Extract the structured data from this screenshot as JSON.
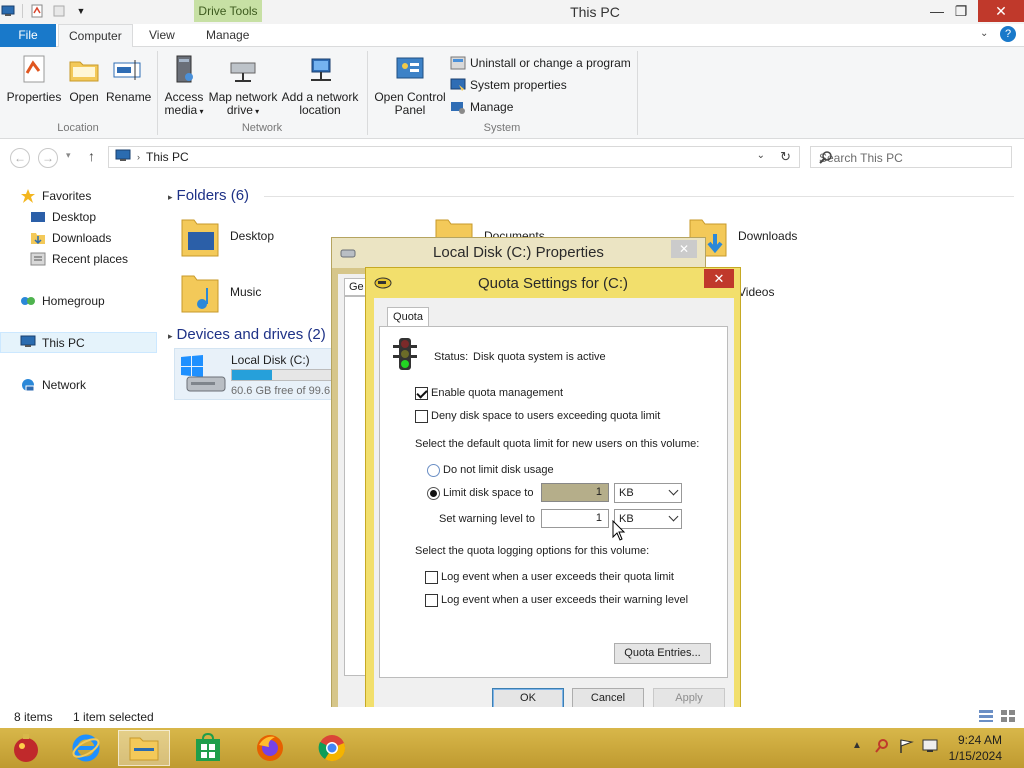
{
  "window": {
    "title": "This PC",
    "context_tab": "Drive Tools"
  },
  "ribbon_tabs": [
    {
      "label": "File"
    },
    {
      "label": "Computer"
    },
    {
      "label": "View"
    },
    {
      "label": "Manage"
    }
  ],
  "ribbon": {
    "location": {
      "label": "Location",
      "buttons": [
        "Properties",
        "Open",
        "Rename"
      ]
    },
    "network": {
      "label": "Network",
      "access_media": "Access\nmedia",
      "map_drive": "Map network\ndrive",
      "add_location": "Add a network\nlocation"
    },
    "system": {
      "label": "System",
      "control_panel": "Open Control\nPanel",
      "uninstall": "Uninstall or change a program",
      "system_props": "System properties",
      "manage": "Manage"
    }
  },
  "address": {
    "path": "This PC",
    "search_placeholder": "Search This PC"
  },
  "nav": {
    "favorites": "Favorites",
    "desktop": "Desktop",
    "downloads": "Downloads",
    "recent": "Recent places",
    "homegroup": "Homegroup",
    "this_pc": "This PC",
    "network": "Network"
  },
  "content": {
    "folders_header": "Folders (6)",
    "folders": [
      "Desktop",
      "Documents",
      "Downloads",
      "Music",
      "Pictures",
      "Videos"
    ],
    "devices_header": "Devices and drives (2)",
    "drive": {
      "name": "Local Disk (C:)",
      "free_text": "60.6 GB free of 99.6 GB",
      "used_fraction": 0.39
    }
  },
  "status": {
    "items": "8 items",
    "selected": "1 item selected"
  },
  "properties_dialog": {
    "title": "Local Disk (C:) Properties",
    "tab_fragment": "Ge"
  },
  "quota_dialog": {
    "title": "Quota Settings for  (C:)",
    "tab": "Quota",
    "status_label": "Status:",
    "status_value": "Disk quota system is active",
    "enable_label": "Enable quota management",
    "enable_checked": true,
    "deny_label": "Deny disk space to users exceeding quota limit",
    "deny_checked": false,
    "default_limit_heading": "Select the default quota limit for new users on this volume:",
    "no_limit_label": "Do not limit disk usage",
    "limit_label": "Limit disk space to",
    "limit_value": "1",
    "limit_unit": "KB",
    "warning_label": "Set warning level to",
    "warning_value": "1",
    "warning_unit": "KB",
    "logging_heading": "Select the quota logging options for this volume:",
    "log_limit_label": "Log event when a user exceeds their quota limit",
    "log_warning_label": "Log event when a user exceeds their warning level",
    "entries_button": "Quota Entries...",
    "ok": "OK",
    "cancel": "Cancel",
    "apply": "Apply"
  },
  "taskbar": {
    "time": "9:24 AM",
    "date": "1/15/2024"
  }
}
